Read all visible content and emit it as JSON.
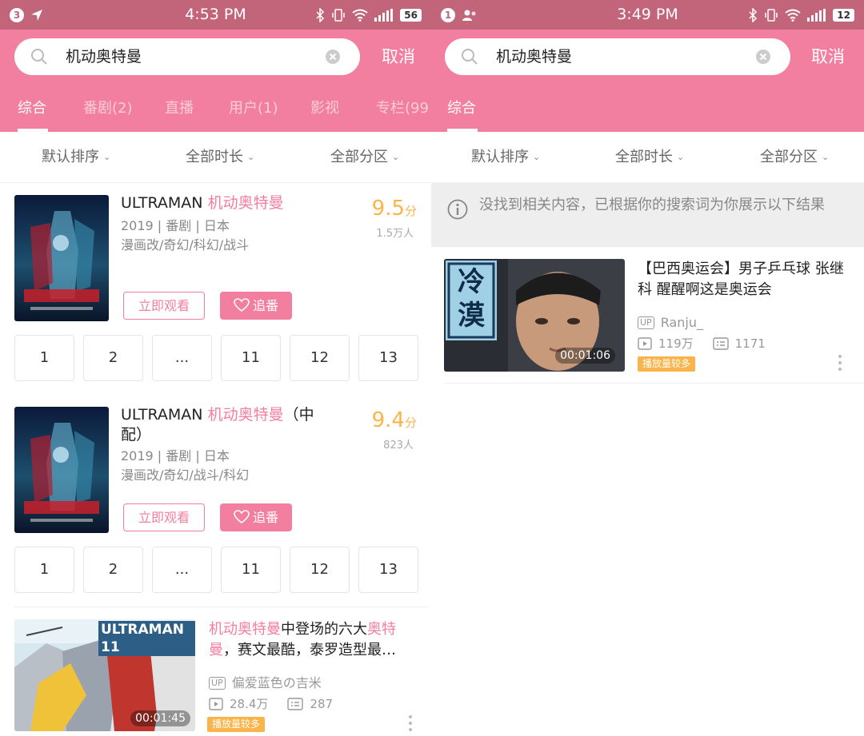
{
  "left": {
    "status": {
      "notif_count": "3",
      "time": "4:53 PM",
      "battery": "56"
    },
    "search": {
      "query": "机动奥特曼",
      "cancel_label": "取消"
    },
    "tabs": [
      "综合",
      "番剧(2)",
      "直播",
      "用户(1)",
      "影视",
      "专栏(99"
    ],
    "filters": [
      "默认排序",
      "全部时长",
      "全部分区"
    ],
    "bangumi": [
      {
        "title_prefix": "ULTRAMAN ",
        "title_highlight": "机动奥特曼",
        "title_suffix": "",
        "meta": "2019 | 番剧 | 日本",
        "tags": "漫画改/奇幻/科幻/战斗",
        "score": "9.5",
        "score_unit": "分",
        "votes": "1.5万人",
        "watch_label": "立即观看",
        "follow_label": "追番",
        "episodes": [
          "1",
          "2",
          "...",
          "11",
          "12",
          "13"
        ]
      },
      {
        "title_prefix": "ULTRAMAN ",
        "title_highlight": "机动奥特曼",
        "title_suffix": "（中配）",
        "meta": "2019 | 番剧 | 日本",
        "tags": "漫画改/奇幻/战斗/科幻",
        "score": "9.4",
        "score_unit": "分",
        "votes": "823人",
        "watch_label": "立即观看",
        "follow_label": "追番",
        "episodes": [
          "1",
          "2",
          "...",
          "11",
          "12",
          "13"
        ]
      }
    ],
    "video": {
      "title_line1_hl": "机动奥特曼",
      "title_line1_text": "中登场的六大",
      "title_line1_hl2": "奥特",
      "title_line2_hl": "曼",
      "title_line2_text": "，赛文最酷，泰罗造型最…",
      "thumb_text": "ULTRAMAN 11",
      "up_tag": "UP",
      "uploader": "偏爱蓝色の吉米",
      "plays": "28.4万",
      "comments": "287",
      "badge": "播放量较多",
      "duration": "00:01:45"
    }
  },
  "right": {
    "status": {
      "notif_count": "1",
      "time": "3:49 PM",
      "battery": "12"
    },
    "search": {
      "query": "机动奥特曼",
      "cancel_label": "取消"
    },
    "tabs": [
      "综合"
    ],
    "filters": [
      "默认排序",
      "全部时长",
      "全部分区"
    ],
    "notice": "没找到相关内容，已根据你的搜索词为你展示以下结果",
    "video": {
      "title": "【巴西奥运会】男子乒乓球 张继科 醒醒啊这是奥运会",
      "thumb_text": "冷漠",
      "up_tag": "UP",
      "uploader": "Ranju_",
      "plays": "119万",
      "comments": "1171",
      "badge": "播放量较多",
      "duration": "00:01:06"
    }
  },
  "colors": {
    "brand_pink": "#f37fa0",
    "status_bar": "#c2647a",
    "score_orange": "#fbb44a"
  }
}
